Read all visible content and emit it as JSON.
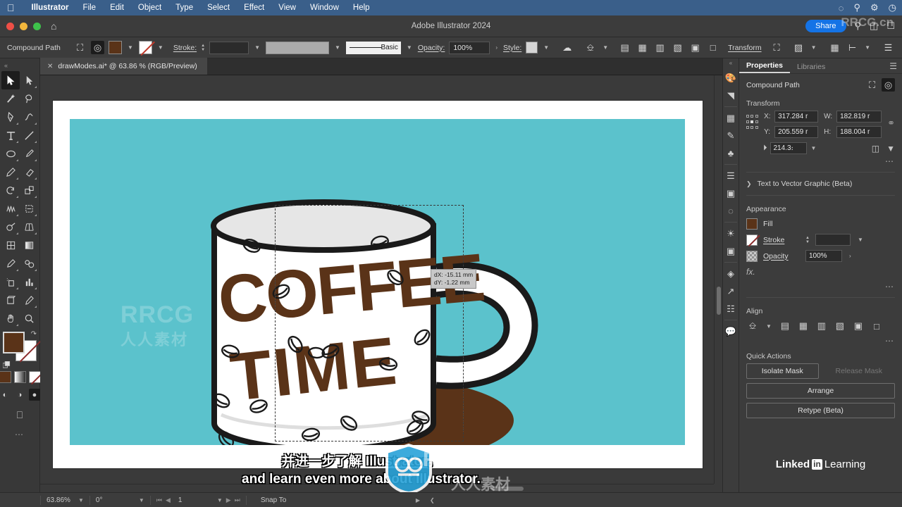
{
  "macbar": {
    "apple_icon": "apple-icon",
    "items": [
      {
        "label": "Illustrator",
        "bold": true
      },
      {
        "label": "File"
      },
      {
        "label": "Edit"
      },
      {
        "label": "Object"
      },
      {
        "label": "Type"
      },
      {
        "label": "Select"
      },
      {
        "label": "Effect"
      },
      {
        "label": "View"
      },
      {
        "label": "Window"
      },
      {
        "label": "Help"
      }
    ],
    "sys_icons": [
      "creative-cloud-icon",
      "search-icon",
      "control-center-icon",
      "clock-icon"
    ]
  },
  "titlebar": {
    "title": "Adobe Illustrator 2024",
    "share_label": "Share",
    "icons": [
      "home-icon",
      "search-icon",
      "workspace-icon",
      "layout-icon"
    ]
  },
  "controlbar": {
    "object_type": "Compound Path",
    "stroke_label": "Stroke:",
    "stroke_width": "",
    "stroke_profile": "Basic",
    "opacity_label": "Opacity:",
    "opacity_value": "100%",
    "style_label": "Style:",
    "transform_label": "Transform",
    "fill_color": "#5a3318",
    "icons": [
      "isolate-mask-icon",
      "edit-contents-icon",
      "fill-swatch",
      "fill-dropdown-icon",
      "stroke-swatch-none",
      "stroke-dropdown-icon",
      "stroke-weight-stepper",
      "stroke-weight-dropdown",
      "variable-width-dropdown",
      "stroke-profile-dropdown",
      "opacity-expand-icon",
      "style-dropdown-icon",
      "recolor-artwork-icon",
      "document-setup-icon",
      "align-left-icon",
      "align-center-h-icon",
      "align-right-icon",
      "align-top-icon",
      "align-center-v-icon",
      "align-bottom-icon",
      "transform-panel-icon",
      "select-similar-icon",
      "arrange-grid-icon",
      "distribute-icon",
      "options-menu-icon"
    ]
  },
  "toolbar": {
    "collapse_icon": "collapse-left-icon",
    "tools": [
      {
        "name": "selection-tool",
        "selected": true
      },
      {
        "name": "direct-selection-tool",
        "selected": false
      },
      {
        "name": "magic-wand-tool",
        "selected": false
      },
      {
        "name": "lasso-tool",
        "selected": false
      },
      {
        "name": "pen-tool",
        "selected": false
      },
      {
        "name": "curvature-tool",
        "selected": false
      },
      {
        "name": "type-tool",
        "selected": false
      },
      {
        "name": "line-segment-tool",
        "selected": false
      },
      {
        "name": "ellipse-tool",
        "selected": false
      },
      {
        "name": "paintbrush-tool",
        "selected": false
      },
      {
        "name": "pencil-tool",
        "selected": false
      },
      {
        "name": "eraser-tool",
        "selected": false
      },
      {
        "name": "rotate-tool",
        "selected": false
      },
      {
        "name": "scale-tool",
        "selected": false
      },
      {
        "name": "width-tool",
        "selected": false
      },
      {
        "name": "free-transform-tool",
        "selected": false
      },
      {
        "name": "shape-builder-tool",
        "selected": false
      },
      {
        "name": "perspective-grid-tool",
        "selected": false
      },
      {
        "name": "mesh-tool",
        "selected": false
      },
      {
        "name": "gradient-tool",
        "selected": false
      },
      {
        "name": "eyedropper-tool",
        "selected": false
      },
      {
        "name": "blend-tool",
        "selected": false
      },
      {
        "name": "symbol-sprayer-tool",
        "selected": false
      },
      {
        "name": "column-graph-tool",
        "selected": false
      },
      {
        "name": "artboard-tool",
        "selected": false
      },
      {
        "name": "slice-tool",
        "selected": false
      },
      {
        "name": "hand-tool",
        "selected": false
      },
      {
        "name": "zoom-tool",
        "selected": false
      }
    ],
    "fill_color": "#5a3318",
    "stroke_color": "none",
    "drawmodes": [
      "draw-normal",
      "draw-behind",
      "draw-inside"
    ],
    "screen_mode": "change-screen-mode-icon",
    "more_tools": "edit-toolbar-icon"
  },
  "document": {
    "tab_label": "drawModes.ai* @ 63.86 % (RGB/Preview)",
    "close_icon": "close-icon",
    "canvas_bg": "#5bc2cc",
    "tooltip": {
      "dx": "dX: -15.11 mm",
      "dy": "dY: -1.22 mm"
    },
    "artwork": {
      "title_line1": "COFFEE",
      "title_line2": "TIME",
      "mug_color": "#ffffff",
      "coffee_color": "#5a3318",
      "saucer_color": "#5a3318",
      "outline_color": "#1a1a1a"
    }
  },
  "subtitles": {
    "chinese": "并进一步了解 Illustrator。",
    "english": "and learn even more about Illustrator."
  },
  "dock_rail": {
    "collapse_icon": "collapse-right-icon",
    "icons": [
      "color-panel-icon",
      "gradient-panel-icon",
      "swatches-panel-icon",
      "brushes-panel-icon",
      "symbols-panel-icon",
      "stroke-panel-icon",
      "transparency-panel-icon",
      "pathfinder-panel-icon",
      "appearance-panel-icon",
      "graphic-styles-panel-icon",
      "layers-panel-icon",
      "artboards-panel-icon",
      "asset-export-panel-icon",
      "comments-panel-icon"
    ]
  },
  "properties": {
    "tabs": [
      {
        "label": "Properties",
        "active": true
      },
      {
        "label": "Libraries",
        "active": false
      }
    ],
    "menu_icon": "panel-menu-icon",
    "object_name": "Compound Path",
    "object_icons": [
      "isolate-selected-object-icon",
      "edit-contents-icon"
    ],
    "transform": {
      "section_label": "Transform",
      "x_label": "X:",
      "x_value": "317.284 r",
      "y_label": "Y:",
      "y_value": "205.559 r",
      "w_label": "W:",
      "w_value": "182.819 r",
      "h_label": "H:",
      "h_value": "188.004 r",
      "angle_label": "angle-icon",
      "angle_value": "214.3։",
      "link_icon": "unlink-proportions-icon",
      "flip_h_icon": "flip-horizontal-icon",
      "flip_v_icon": "flip-vertical-icon",
      "more_icon": "more-options-icon"
    },
    "text_to_vector": {
      "label": "Text to Vector Graphic (Beta)",
      "chevron": "chevron-right-icon"
    },
    "appearance": {
      "section_label": "Appearance",
      "fill_label": "Fill",
      "fill_color": "#5a3318",
      "stroke_label": "Stroke",
      "stroke_value": "",
      "opacity_label": "Opacity",
      "opacity_value": "100%",
      "fx_label": "fx.",
      "more_icon": "more-options-icon"
    },
    "align": {
      "section_label": "Align",
      "icons": [
        "align-to-selection-icon",
        "align-left-icon",
        "align-center-h-icon",
        "align-right-icon",
        "align-top-icon",
        "align-center-v-icon",
        "align-bottom-icon"
      ],
      "more_icon": "more-options-icon"
    },
    "quick_actions": {
      "section_label": "Quick Actions",
      "buttons": [
        {
          "label": "Isolate Mask",
          "disabled": false
        },
        {
          "label": "Release Mask",
          "disabled": true
        },
        {
          "label": "Arrange",
          "disabled": false
        },
        {
          "label": "Retype (Beta)",
          "disabled": false
        }
      ]
    },
    "branding": {
      "name": "Linked",
      "in": "in",
      "learning": "Learning"
    }
  },
  "statusbar": {
    "zoom_value": "63.86%",
    "rotation_value": "0°",
    "artboard_number": "1",
    "snap_label": "Snap To",
    "nav_icons": [
      "first-artboard-icon",
      "prev-artboard-icon",
      "next-artboard-icon",
      "last-artboard-icon"
    ],
    "expand_icon": "expand-status-icon",
    "collapse_icon": "collapse-status-icon"
  },
  "watermarks": {
    "top_right": "RRCG.cn",
    "canvas_left": "RRCG",
    "canvas_left_cn": "人人素材",
    "center": "RRCG.cn",
    "center_cn": "人人素材"
  },
  "colors": {
    "accent_blue": "#1473e6",
    "menubar_blue": "#3a5f8a",
    "panel_bg": "#3c3c3c",
    "canvas_teal": "#5bc2cc",
    "coffee_brown": "#5a3318"
  }
}
